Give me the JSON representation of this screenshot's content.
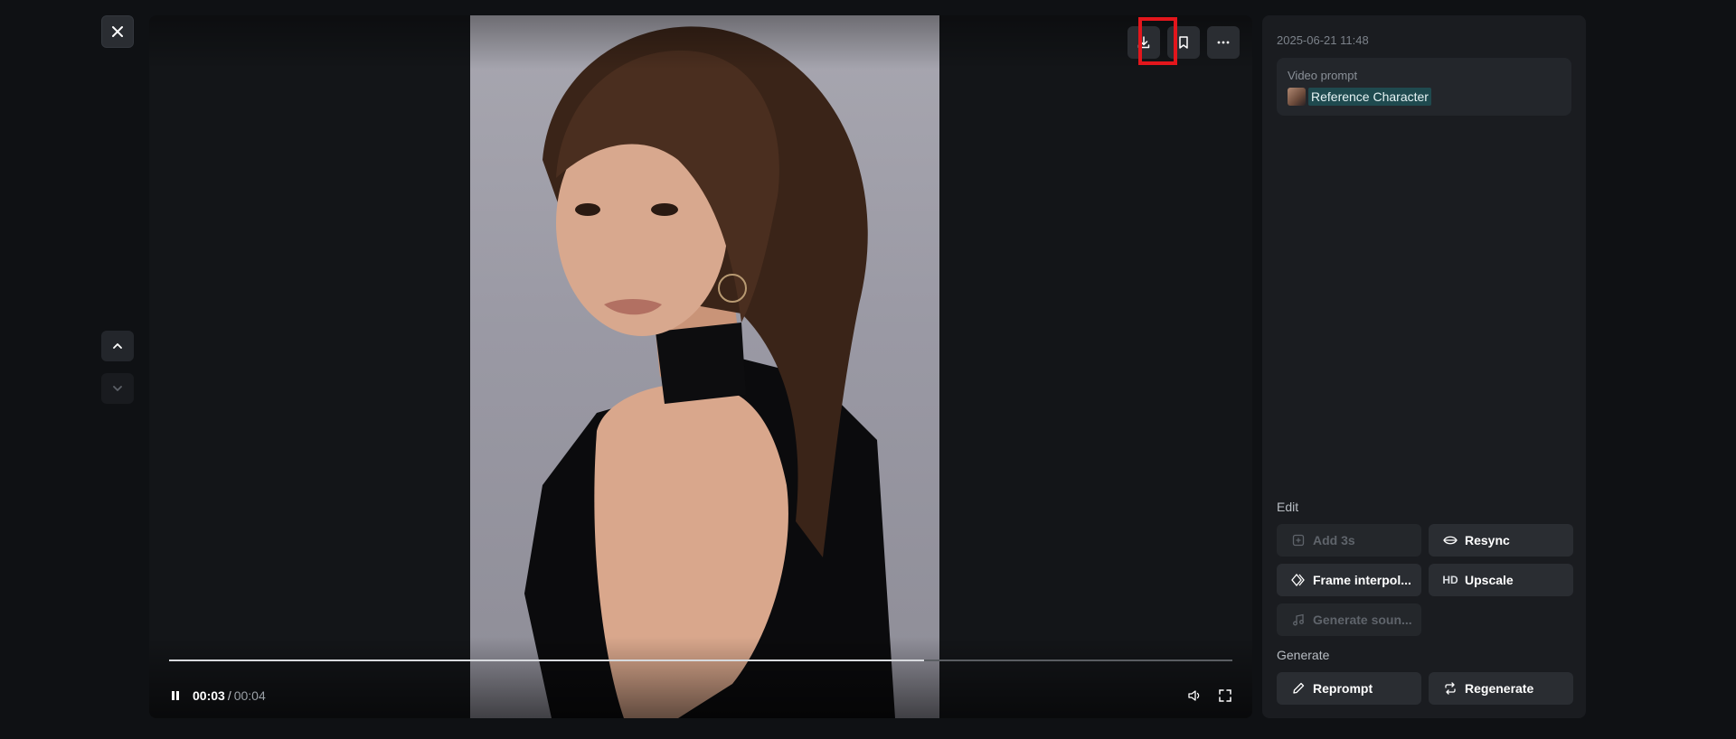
{
  "viewer": {
    "close_icon": "close-icon",
    "nav_up_icon": "chevron-up-icon",
    "nav_down_icon": "chevron-down-icon"
  },
  "video": {
    "actions": {
      "download_icon": "download-icon",
      "bookmark_icon": "bookmark-icon",
      "more_icon": "more-horizontal-icon"
    },
    "player": {
      "current_time": "00:03",
      "separator": "/",
      "total_time": "00:04",
      "progress_fraction": 0.71,
      "pause_icon": "pause-icon",
      "volume_icon": "volume-icon",
      "fullscreen_icon": "fullscreen-icon"
    },
    "highlight_color": "#e3161c"
  },
  "sidebar": {
    "timestamp": "2025-06-21 11:48",
    "prompt": {
      "label": "Video prompt",
      "reference": "Reference Character"
    },
    "edit": {
      "label": "Edit",
      "buttons": [
        {
          "label": "Add 3s",
          "icon": "add-clip-icon",
          "enabled": false
        },
        {
          "label": "Resync",
          "icon": "lips-icon",
          "enabled": true
        },
        {
          "label": "Frame interpol...",
          "icon": "diamond-frames-icon",
          "enabled": true
        },
        {
          "label": "Upscale",
          "icon": "HD",
          "enabled": true
        },
        {
          "label": "Generate soun...",
          "icon": "music-note-icon",
          "enabled": false
        }
      ]
    },
    "generate": {
      "label": "Generate",
      "buttons": [
        {
          "label": "Reprompt",
          "icon": "pencil-icon"
        },
        {
          "label": "Regenerate",
          "icon": "repeat-icon"
        }
      ]
    }
  }
}
